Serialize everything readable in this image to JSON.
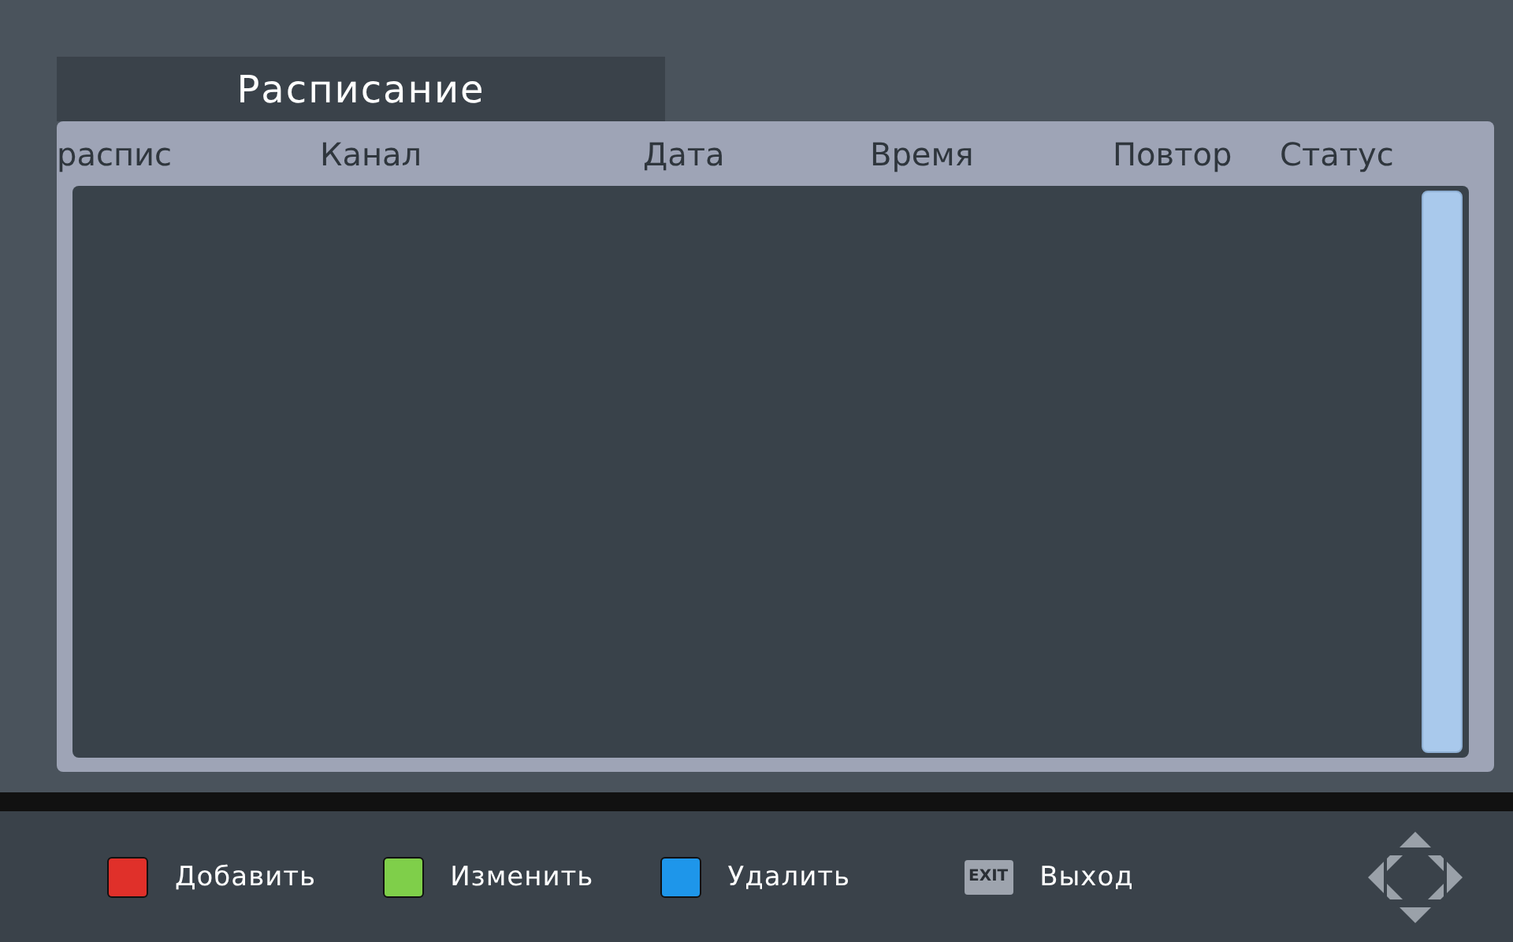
{
  "title_tab": {
    "label": "Расписание"
  },
  "table": {
    "columns": [
      "распис",
      "Канал",
      "Дата",
      "Время",
      "Повтор",
      "Статус"
    ]
  },
  "legend": [
    {
      "kind": "color",
      "color": "#e0302a",
      "label": "Добавить"
    },
    {
      "kind": "color",
      "color": "#7fcf4a",
      "label": "Изменить"
    },
    {
      "kind": "color",
      "color": "#1e96ea",
      "label": "Удалить"
    },
    {
      "kind": "key",
      "key": "EXIT",
      "label": "Выход"
    }
  ]
}
